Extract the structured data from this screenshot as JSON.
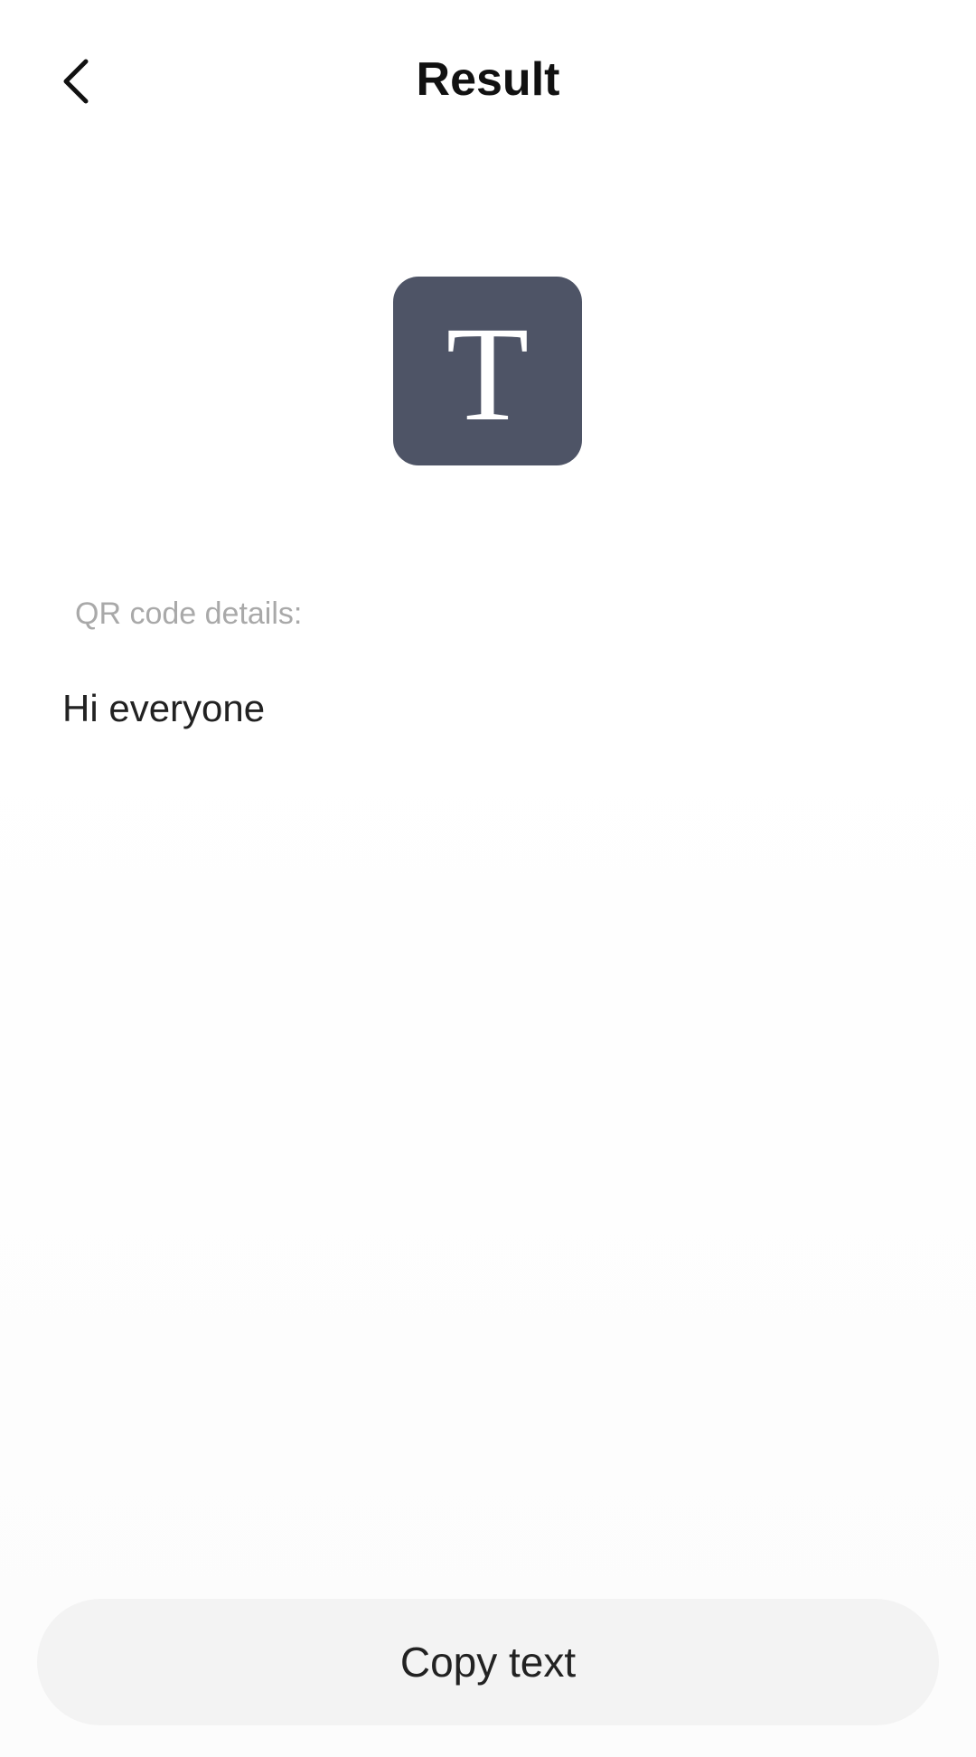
{
  "header": {
    "title": "Result",
    "back_icon": "chevron-left-icon"
  },
  "result": {
    "type_icon": "text-type-icon",
    "type_glyph": "T",
    "type_icon_color": "#4e5466",
    "details_label": "QR code details:",
    "details_value": "Hi everyone"
  },
  "actions": {
    "copy_label": "Copy text"
  }
}
